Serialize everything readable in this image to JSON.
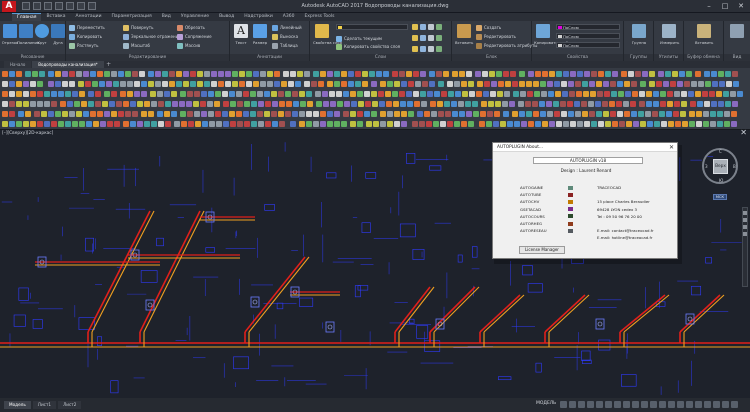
{
  "window": {
    "title": "Autodesk AutoCAD 2017   Водопроводы канализация.dwg",
    "logo": "A"
  },
  "ribbon_tabs": [
    "Главная",
    "Вставка",
    "Аннотации",
    "Параметризация",
    "Вид",
    "Управление",
    "Вывод",
    "Надстройки",
    "A360",
    "Express Tools"
  ],
  "ribbon_panels": {
    "draw": {
      "label": "Рисование",
      "big_tools": [
        "Отрезок",
        "Полилиния",
        "Круг",
        "Дуга"
      ]
    },
    "modify": {
      "label": "Редактирование",
      "small_tools": [
        "Переместить",
        "Копировать",
        "Растянуть",
        "Повернуть",
        "Зеркальное отражение",
        "Масштаб",
        "Обрезать",
        "Сопряжение",
        "Массив"
      ]
    },
    "annotation": {
      "label": "Аннотации",
      "big_tools": [
        "Текст",
        "Размер"
      ],
      "small_tools": [
        "Линейный",
        "Выноска",
        "Таблица"
      ]
    },
    "layers": {
      "label": "Слои",
      "big_tools": [
        "Свойства слоя"
      ],
      "small_tools": [
        "Сделать текущим",
        "Копировать свойства слоя"
      ]
    },
    "block": {
      "label": "Блок",
      "big_tools": [
        "Вставить"
      ],
      "small_tools": [
        "Создать",
        "Редактировать",
        "Редактировать атрибуты"
      ]
    },
    "properties": {
      "label": "Свойства",
      "big_tools": [
        "Копировать свойства"
      ],
      "combos": [
        "ПоСлою",
        "ПоСлою",
        "ПоСлою"
      ]
    },
    "groups": {
      "label": "Группы",
      "big_tools": [
        "Группа"
      ]
    },
    "utilities": {
      "label": "Утилиты",
      "big_tools": [
        "Измерить"
      ]
    },
    "clipboard": {
      "label": "Буфер обмена",
      "big_tools": [
        "Вставить"
      ]
    },
    "view": {
      "label": "Вид"
    }
  },
  "file_tabs": [
    "Начало",
    "Водопроводы канализация*"
  ],
  "viewport": {
    "label": "[–][Сверху][2D-каркас]"
  },
  "viewcube": {
    "face": "Верх",
    "north": "С",
    "south": "Ю",
    "west": "З",
    "east": "В",
    "wcs": "МСК"
  },
  "about_dialog": {
    "title": "AUTOPLUGIN About...",
    "version": "AUTOPLUGIN v18",
    "design": "Design : Laurent Renard",
    "products": [
      {
        "name": "AUTOGAINE",
        "color": "#5f8a7a"
      },
      {
        "name": "AUTOTUBE",
        "color": "#8b2222"
      },
      {
        "name": "AUTOCHV",
        "color": "#c27a00"
      },
      {
        "name": "GSETACAD",
        "color": "#7b2a8a"
      },
      {
        "name": "AUTOCOURS",
        "color": "#2d4b2d"
      },
      {
        "name": "AUTORHEG",
        "color": "#8f3b1c"
      },
      {
        "name": "AUTORESEAU",
        "color": "#555a60"
      }
    ],
    "contact": [
      "TRACEOCAD",
      "",
      "15 place Charles Beraudier",
      "69428 LYON cedex 3",
      "Tel : 09 50 96 76 20 00",
      "",
      "E.mail: contact@traceocad.fr",
      "E.mail: hotline@traceocad.fr"
    ],
    "license_button": "License Manager"
  },
  "layout_tabs": [
    "Модель",
    "Лист1",
    "Лист2"
  ],
  "statusbar": {
    "model": "МОДЕЛЬ"
  },
  "theme": {
    "canvas_bg": "#1e222b",
    "pipe_red": "#e0201b",
    "pipe_orange": "#f0a020",
    "linework_blue": "#2f3bff"
  }
}
